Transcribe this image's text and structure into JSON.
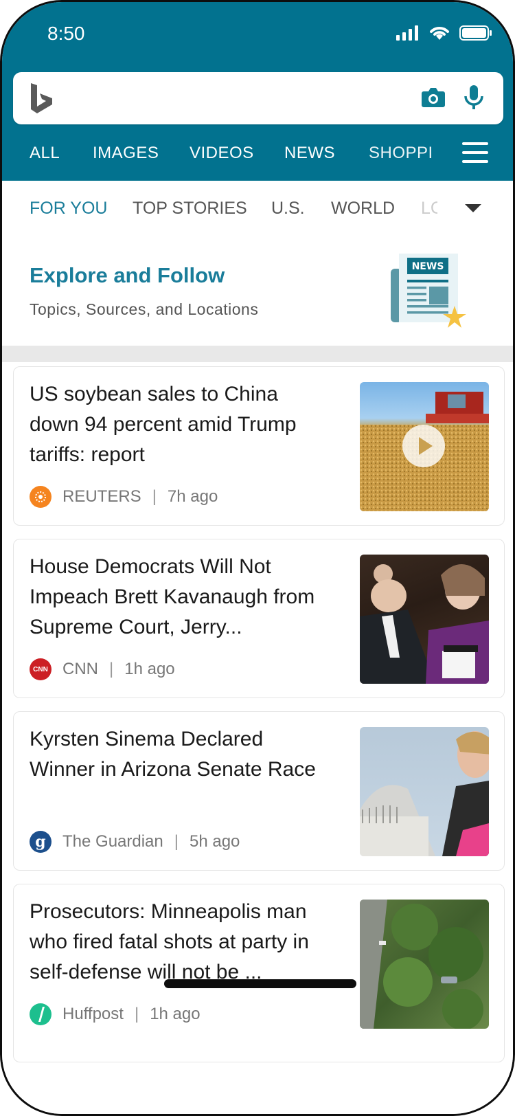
{
  "status": {
    "time": "8:50"
  },
  "icons": [
    "bing-logo",
    "camera-icon",
    "microphone-icon",
    "menu-icon",
    "chevron-down-icon",
    "play-icon",
    "signal-icon",
    "wifi-icon",
    "battery-icon"
  ],
  "colors": {
    "header": "#02728f",
    "accent": "#1a7d9a"
  },
  "search": {
    "placeholder": ""
  },
  "tabs": [
    {
      "label": "ALL"
    },
    {
      "label": "IMAGES"
    },
    {
      "label": "VIDEOS"
    },
    {
      "label": "NEWS"
    },
    {
      "label": "SHOPPI"
    }
  ],
  "subtabs": [
    {
      "label": "FOR YOU",
      "active": true
    },
    {
      "label": "TOP STORIES"
    },
    {
      "label": "U.S."
    },
    {
      "label": "WORLD"
    },
    {
      "label": "LC"
    }
  ],
  "explore": {
    "title": "Explore and Follow",
    "subtitle": "Topics, Sources, and Locations",
    "badge": "NEWS"
  },
  "articles": [
    {
      "headline": "US soybean sales to China down 94 percent amid Trump tariffs: report",
      "source": "REUTERS",
      "time": "7h ago",
      "has_video": true
    },
    {
      "headline": "House Democrats Will Not Impeach Brett Kavanaugh from Supreme Court, Jerry...",
      "source": "CNN",
      "time": "1h ago",
      "source_logo_text": "CNN"
    },
    {
      "headline": "Kyrsten Sinema Declared Winner in Arizona Senate Race",
      "source": "The Guardian",
      "time": "5h ago",
      "source_logo_text": "g"
    },
    {
      "headline": "Prosecutors: Minneapolis man who fired fatal shots at party in self-defense will not be ...",
      "source": "Huffpost",
      "time": "1h ago"
    }
  ]
}
